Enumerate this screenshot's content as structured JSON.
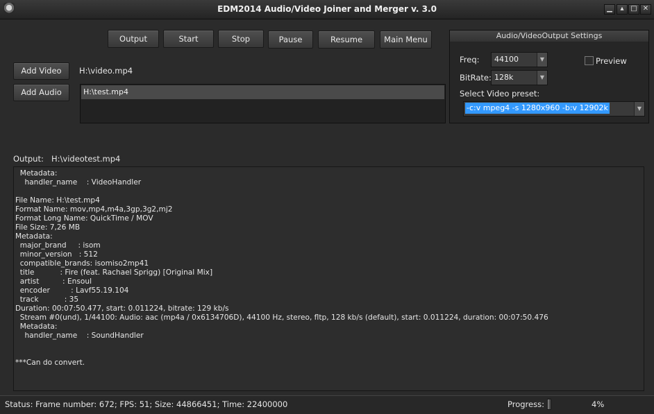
{
  "window": {
    "title": "EDM2014 Audio/Video Joiner and Merger v. 3.0",
    "app_icon": "app-logo-icon",
    "controls": {
      "minimize": "▁",
      "restore": "▴",
      "maximize": "□",
      "close": "✕"
    }
  },
  "toolbar": {
    "output": "Output",
    "start": "Start",
    "stop": "Stop",
    "pause": "Pause",
    "resume": "Resume",
    "main_menu": "Main Menu"
  },
  "inputs": {
    "add_video": "Add Video",
    "video_path": "H:\\video.mp4",
    "add_audio": "Add Audio",
    "audio_files": [
      "H:\\test.mp4"
    ]
  },
  "settings": {
    "header": "Audio/VideoOutput Settings",
    "freq_label": "Freq:",
    "freq_value": "44100",
    "bitrate_label": "BitRate:",
    "bitrate_value": "128k",
    "preview_label": "Preview",
    "preview_checked": false,
    "preset_label": "Select Video preset:",
    "preset_value": "-c:v mpeg4 -s 1280x960 -b:v 12902k"
  },
  "output": {
    "label": "Output:",
    "path": "H:\\videotest.mp4"
  },
  "log": {
    "lines": [
      "  Metadata:",
      "    handler_name    : VideoHandler",
      "",
      "File Name: H:\\test.mp4",
      "Format Name: mov,mp4,m4a,3gp,3g2,mj2",
      "Format Long Name: QuickTime / MOV",
      "File Size: 7,26 MB",
      "Metadata:",
      "  major_brand     : isom",
      "  minor_version   : 512",
      "  compatible_brands: isomiso2mp41",
      "  title           : Fire (feat. Rachael Sprigg) [Original Mix]",
      "  artist          : Ensoul",
      "  encoder         : Lavf55.19.104",
      "  track           : 35",
      "Duration: 00:07:50.477, start: 0.011224, bitrate: 129 kb/s",
      "  Stream #0(und), 1/44100: Audio: aac (mp4a / 0x6134706D), 44100 Hz, stereo, fltp, 128 kb/s (default), start: 0.011224, duration: 00:07:50.476",
      "  Metadata:",
      "    handler_name    : SoundHandler",
      "",
      "",
      "***Can do convert."
    ]
  },
  "status": {
    "text": "Status:  Frame number: 672; FPS: 51; Size: 44866451; Time: 22400000",
    "progress_label": "Progress:",
    "progress_percent": 4,
    "progress_text": "4%"
  }
}
